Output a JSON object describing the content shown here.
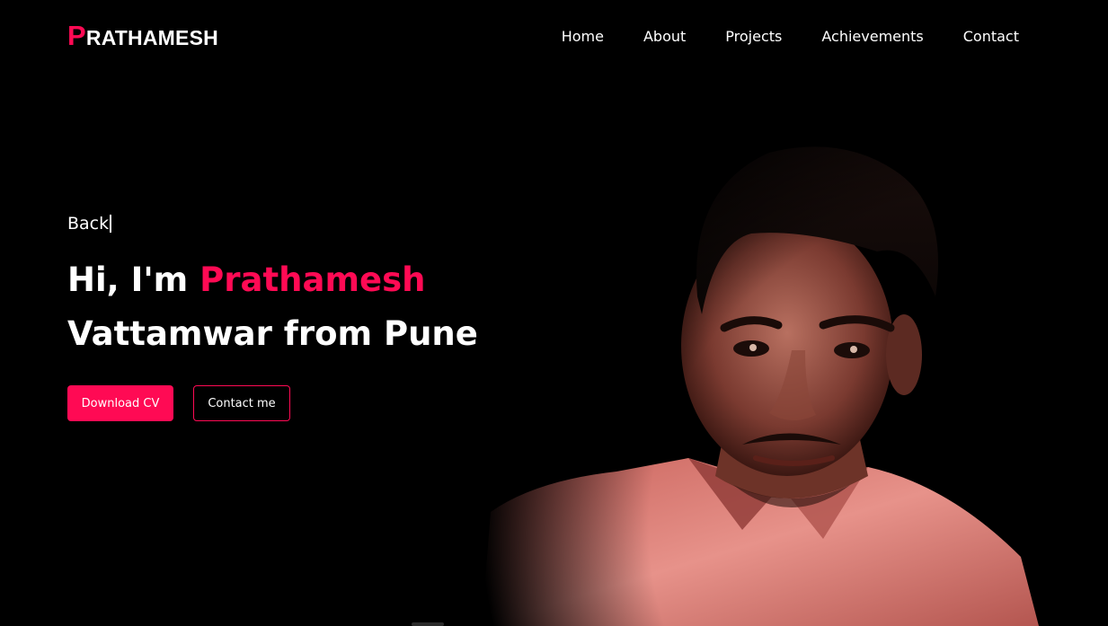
{
  "nav": {
    "logo_first": "P",
    "logo_rest": "RATHAMESH",
    "links": [
      "Home",
      "About",
      "Projects",
      "Achievements",
      "Contact"
    ]
  },
  "hero": {
    "typed_text": "Back",
    "headline_prefix": "Hi, I'm ",
    "headline_name": "Prathamesh",
    "headline_line2": "Vattamwar from Pune",
    "download_button": "Download CV",
    "contact_button": "Contact me"
  },
  "colors": {
    "accent": "#ff0a54",
    "background": "#000000",
    "text": "#ffffff"
  },
  "icons": {
    "portrait": "person-photo"
  }
}
